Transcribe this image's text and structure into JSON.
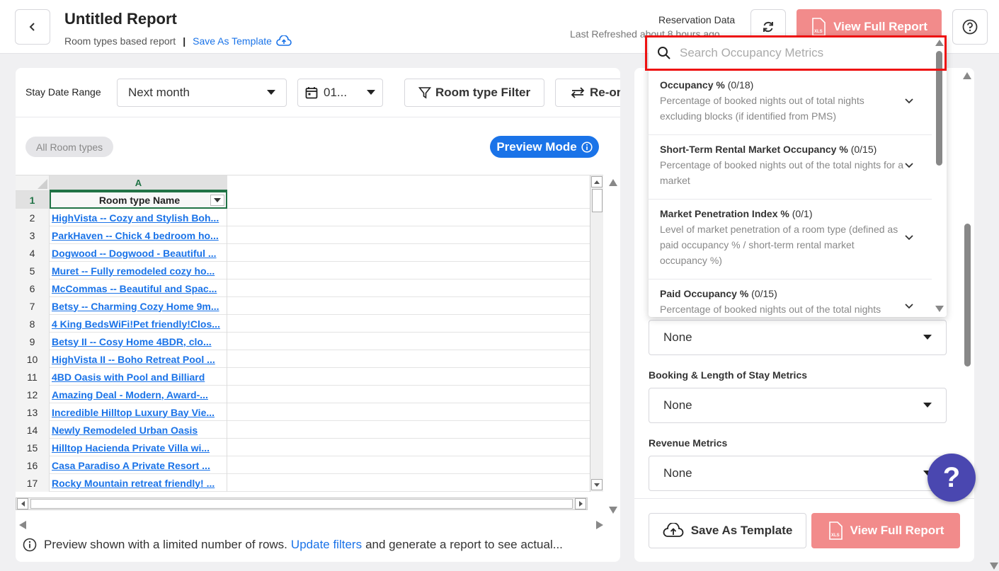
{
  "header": {
    "title": "Untitled Report",
    "subtitle": "Room types based report",
    "separator": "|",
    "save_template_link": "Save As Template",
    "reservation_data": "Reservation Data",
    "last_refreshed": "Last Refreshed about 8 hours ago",
    "view_full_report": "View Full Report",
    "xls_badge": "XLS"
  },
  "filters": {
    "stay_date_label": "Stay Date Range",
    "stay_date_value": "Next month",
    "date_value": "01...",
    "room_type_filter": "Room type Filter",
    "reorder": "Re-or"
  },
  "chip_all_room_types": "All Room types",
  "preview_mode": "Preview Mode",
  "grid": {
    "column_letter": "A",
    "header_row_number": "1",
    "header": "Room type Name",
    "rows": [
      {
        "n": "2",
        "name": "HighVista -- Cozy and Stylish Boh..."
      },
      {
        "n": "3",
        "name": "ParkHaven -- Chick 4 bedroom ho..."
      },
      {
        "n": "4",
        "name": "Dogwood -- Dogwood - Beautiful ..."
      },
      {
        "n": "5",
        "name": "Muret -- Fully remodeled cozy ho..."
      },
      {
        "n": "6",
        "name": "McCommas -- Beautiful and Spac..."
      },
      {
        "n": "7",
        "name": "Betsy -- Charming Cozy Home 9m..."
      },
      {
        "n": "8",
        "name": "4 King BedsWiFi!Pet friendly!Clos..."
      },
      {
        "n": "9",
        "name": "Betsy II -- Cosy Home  4BDR, clo..."
      },
      {
        "n": "10",
        "name": "HighVista II -- Boho Retreat Pool ..."
      },
      {
        "n": "11",
        "name": "4BD Oasis with Pool and Billiard"
      },
      {
        "n": "12",
        "name": "Amazing Deal - Modern, Award-..."
      },
      {
        "n": "13",
        "name": "Incredible Hilltop Luxury Bay Vie..."
      },
      {
        "n": "14",
        "name": "Newly Remodeled Urban Oasis"
      },
      {
        "n": "15",
        "name": " Hilltop Hacienda  Private Villa wi..."
      },
      {
        "n": "16",
        "name": " Casa Paradiso  A Private Resort ..."
      },
      {
        "n": "17",
        "name": "Rocky Mountain retreat  friendly! ..."
      }
    ]
  },
  "footer_note": {
    "text1": "Preview shown with a limited number of rows.",
    "link": "Update filters",
    "text2": "and generate a report to see actual..."
  },
  "search": {
    "placeholder": "Search Occupancy Metrics"
  },
  "occupancy_metrics": [
    {
      "title": "Occupancy %",
      "count": "(0/18)",
      "desc": "Percentage of booked nights out of total nights excluding blocks (if identified from PMS)"
    },
    {
      "title": "Short-Term Rental Market Occupancy %",
      "count": "(0/15)",
      "desc": "Percentage of booked nights out of the total nights for a market"
    },
    {
      "title": "Market Penetration Index %",
      "count": "(0/1)",
      "desc": "Level of market penetration of a room type (defined as paid occupancy % / short-term rental market occupancy %)"
    },
    {
      "title": "Paid Occupancy %",
      "count": "(0/15)",
      "desc": "Percentage of booked nights out of the total nights"
    }
  ],
  "right_panel": {
    "occupancy_select": "None",
    "booking_label": "Booking & Length of Stay Metrics",
    "booking_select": "None",
    "revenue_label": "Revenue Metrics",
    "revenue_select": "None",
    "save_template": "Save As Template",
    "view_full_report": "View Full Report"
  },
  "help_bubble": "?",
  "colors": {
    "accent": "#1a73e8",
    "primary_disabled": "#f28b8b",
    "grid_green": "#217346",
    "help_purple": "#4a47b0",
    "highlight_red": "#ee1111"
  },
  "icons": {
    "back": "chevron-left-icon",
    "refresh": "refresh-icon",
    "help": "help-circle-icon",
    "cloud_upload": "cloud-upload-icon",
    "xls": "xls-file-icon",
    "calendar": "calendar-icon",
    "filter": "filter-icon",
    "reorder": "swap-arrows-icon",
    "info": "info-icon",
    "search": "search-icon",
    "chevron_down": "chevron-down-icon"
  }
}
